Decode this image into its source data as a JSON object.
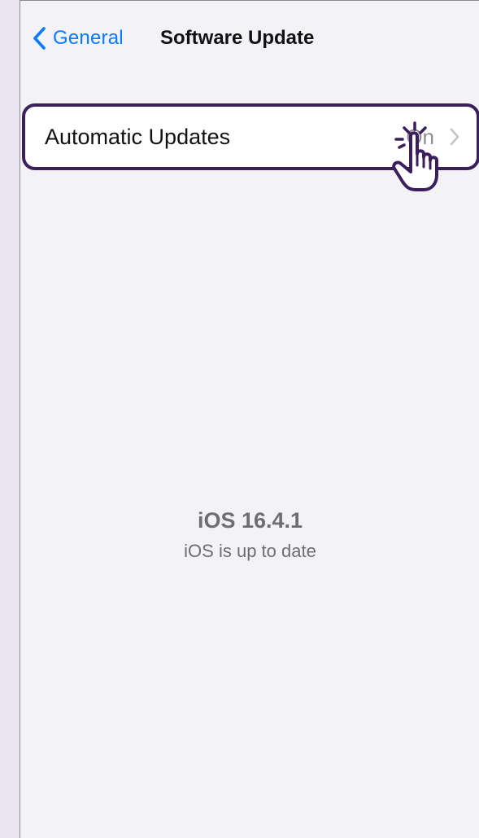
{
  "nav": {
    "back_label": "General",
    "title": "Software Update",
    "back_icon": "chevron-left-icon"
  },
  "settings": {
    "automatic_updates_label": "Automatic Updates",
    "automatic_updates_value": "On",
    "chevron_icon": "chevron-right-icon"
  },
  "overlay": {
    "cursor_icon": "hand-pointer-icon"
  },
  "version": {
    "title": "iOS 16.4.1",
    "status": "iOS is up to date"
  },
  "colors": {
    "accent": "#0a7aff",
    "highlight_border": "#3a1f5c",
    "background": "#f2f2f7",
    "outer_background": "#e9e4f0",
    "secondary_text": "#8e8e93"
  }
}
